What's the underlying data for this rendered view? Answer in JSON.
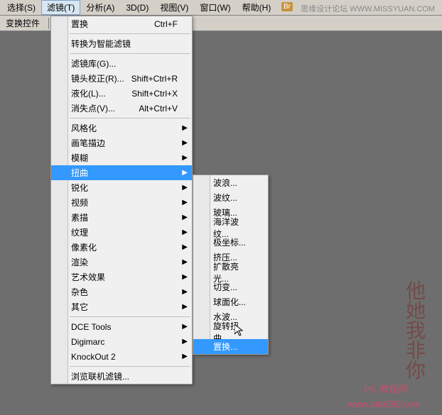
{
  "menubar": {
    "items": [
      {
        "label": "选择(S)"
      },
      {
        "label": "滤镜(T)"
      },
      {
        "label": "分析(A)"
      },
      {
        "label": "3D(D)"
      },
      {
        "label": "视图(V)"
      },
      {
        "label": "窗口(W)"
      },
      {
        "label": "帮助(H)"
      }
    ],
    "badge": "Br",
    "top_text": "思缘设计论坛 WWW.MISSYUAN.COM"
  },
  "toolbar": {
    "label": "变换控件"
  },
  "menu": {
    "group1": [
      {
        "label": "置换",
        "shortcut": "Ctrl+F"
      }
    ],
    "group2": [
      {
        "label": "转换为智能滤镜"
      }
    ],
    "group3": [
      {
        "label": "滤镜库(G)..."
      },
      {
        "label": "镜头校正(R)...",
        "shortcut": "Shift+Ctrl+R"
      },
      {
        "label": "液化(L)...",
        "shortcut": "Shift+Ctrl+X"
      },
      {
        "label": "消失点(V)...",
        "shortcut": "Alt+Ctrl+V"
      }
    ],
    "group4": [
      {
        "label": "风格化",
        "arrow": true
      },
      {
        "label": "画笔描边",
        "arrow": true
      },
      {
        "label": "模糊",
        "arrow": true
      },
      {
        "label": "扭曲",
        "arrow": true,
        "selected": true
      },
      {
        "label": "锐化",
        "arrow": true
      },
      {
        "label": "视频",
        "arrow": true
      },
      {
        "label": "素描",
        "arrow": true
      },
      {
        "label": "纹理",
        "arrow": true
      },
      {
        "label": "像素化",
        "arrow": true
      },
      {
        "label": "渲染",
        "arrow": true
      },
      {
        "label": "艺术效果",
        "arrow": true
      },
      {
        "label": "杂色",
        "arrow": true
      },
      {
        "label": "其它",
        "arrow": true
      }
    ],
    "group5": [
      {
        "label": "DCE Tools",
        "arrow": true
      },
      {
        "label": "Digimarc",
        "arrow": true
      },
      {
        "label": "KnockOut 2",
        "arrow": true
      }
    ],
    "group6": [
      {
        "label": "浏览联机滤镜..."
      }
    ]
  },
  "submenu": {
    "items": [
      {
        "label": "波浪..."
      },
      {
        "label": "波纹..."
      },
      {
        "label": "玻璃..."
      },
      {
        "label": "海洋波纹..."
      },
      {
        "label": "极坐标..."
      },
      {
        "label": "挤压..."
      },
      {
        "label": "扩散亮光..."
      },
      {
        "label": "切变..."
      },
      {
        "label": "球面化..."
      },
      {
        "label": "水波..."
      },
      {
        "label": "旋转扭曲..."
      },
      {
        "label": "置换...",
        "selected": true
      }
    ]
  },
  "footer": {
    "line1": "PS 教程网",
    "line2": "www.tata580.com"
  },
  "watermark": "他她我非你"
}
